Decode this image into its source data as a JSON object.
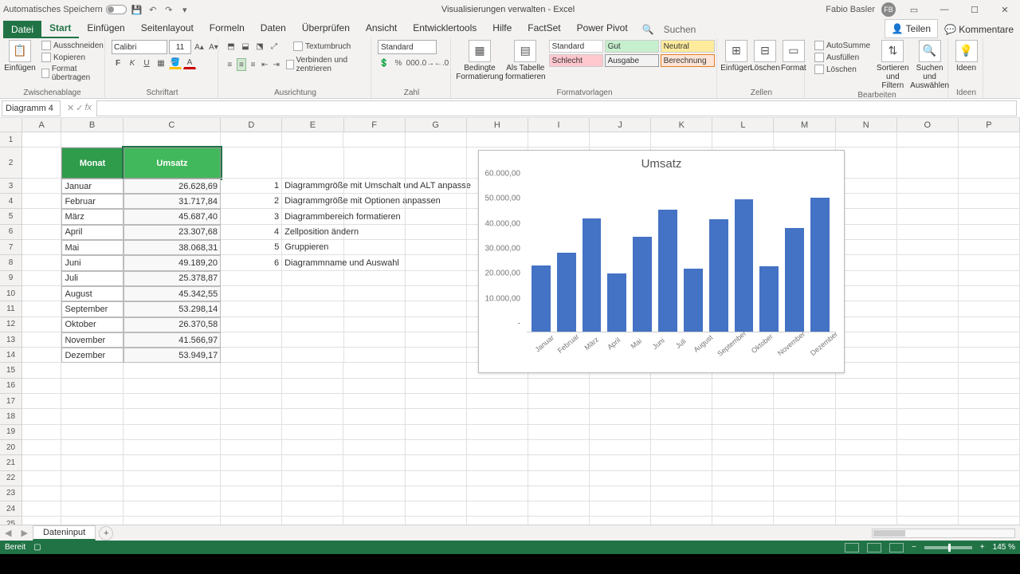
{
  "titlebar": {
    "autosave": "Automatisches Speichern",
    "doc": "Visualisierungen verwalten",
    "app": "Excel",
    "user": "Fabio Basler",
    "initials": "FB"
  },
  "tabs": {
    "file": "Datei",
    "items": [
      "Start",
      "Einfügen",
      "Seitenlayout",
      "Formeln",
      "Daten",
      "Überprüfen",
      "Ansicht",
      "Entwicklertools",
      "Hilfe",
      "FactSet",
      "Power Pivot"
    ],
    "active": 0,
    "search": "Suchen",
    "share": "Teilen",
    "comments": "Kommentare"
  },
  "ribbon": {
    "clipboard": {
      "label": "Zwischenablage",
      "paste": "Einfügen",
      "cut": "Ausschneiden",
      "copy": "Kopieren",
      "format": "Format übertragen"
    },
    "font": {
      "label": "Schriftart",
      "name": "Calibri",
      "size": "11"
    },
    "align": {
      "label": "Ausrichtung",
      "wrap": "Textumbruch",
      "merge": "Verbinden und zentrieren"
    },
    "number": {
      "label": "Zahl",
      "format": "Standard"
    },
    "styles": {
      "label": "Formatvorlagen",
      "cond": "Bedingte Formatierung",
      "astable": "Als Tabelle formatieren",
      "standard": "Standard",
      "gut": "Gut",
      "neutral": "Neutral",
      "schlecht": "Schlecht",
      "ausgabe": "Ausgabe",
      "berechnung": "Berechnung"
    },
    "cells": {
      "label": "Zellen",
      "insert": "Einfügen",
      "delete": "Löschen",
      "format": "Format"
    },
    "editing": {
      "label": "Bearbeiten",
      "sum": "AutoSumme",
      "fill": "Ausfüllen",
      "clear": "Löschen",
      "sort": "Sortieren und Filtern",
      "find": "Suchen und Auswählen"
    },
    "ideas": {
      "label": "Ideen",
      "btn": "Ideen"
    }
  },
  "namebox": "Diagramm 4",
  "columns": [
    "A",
    "B",
    "C",
    "D",
    "E",
    "F",
    "G",
    "H",
    "I",
    "J",
    "K",
    "L",
    "M",
    "N",
    "O",
    "P"
  ],
  "table": {
    "headers": {
      "monat": "Monat",
      "umsatz": "Umsatz"
    },
    "rows": [
      {
        "m": "Januar",
        "v": "26.628,69"
      },
      {
        "m": "Februar",
        "v": "31.717,84"
      },
      {
        "m": "März",
        "v": "45.687,40"
      },
      {
        "m": "April",
        "v": "23.307,68"
      },
      {
        "m": "Mai",
        "v": "38.068,31"
      },
      {
        "m": "Juni",
        "v": "49.189,20"
      },
      {
        "m": "Juli",
        "v": "25.378,87"
      },
      {
        "m": "August",
        "v": "45.342,55"
      },
      {
        "m": "September",
        "v": "53.298,14"
      },
      {
        "m": "Oktober",
        "v": "26.370,58"
      },
      {
        "m": "November",
        "v": "41.566,97"
      },
      {
        "m": "Dezember",
        "v": "53.949,17"
      }
    ]
  },
  "notes": [
    "Diagrammgröße mit Umschalt und ALT anpasse",
    "Diagrammgröße mit Optionen anpassen",
    "Diagrammbereich formatieren",
    "Zellposition ändern",
    "Gruppieren",
    "Diagrammname und Auswahl"
  ],
  "chart_data": {
    "type": "bar",
    "title": "Umsatz",
    "categories": [
      "Januar",
      "Februar",
      "März",
      "April",
      "Mai",
      "Juni",
      "Juli",
      "August",
      "September",
      "Oktober",
      "November",
      "Dezember"
    ],
    "values": [
      26628.69,
      31717.84,
      45687.4,
      23307.68,
      38068.31,
      49189.2,
      25378.87,
      45342.55,
      53298.14,
      26370.58,
      41566.97,
      53949.17
    ],
    "ylim": [
      0,
      60000
    ],
    "yticks": [
      "-",
      "10.000,00",
      "20.000,00",
      "30.000,00",
      "40.000,00",
      "50.000,00",
      "60.000,00"
    ],
    "xlabel": "",
    "ylabel": ""
  },
  "sheet": {
    "tab": "Dateninput"
  },
  "status": {
    "ready": "Bereit",
    "zoom": "145 %"
  }
}
